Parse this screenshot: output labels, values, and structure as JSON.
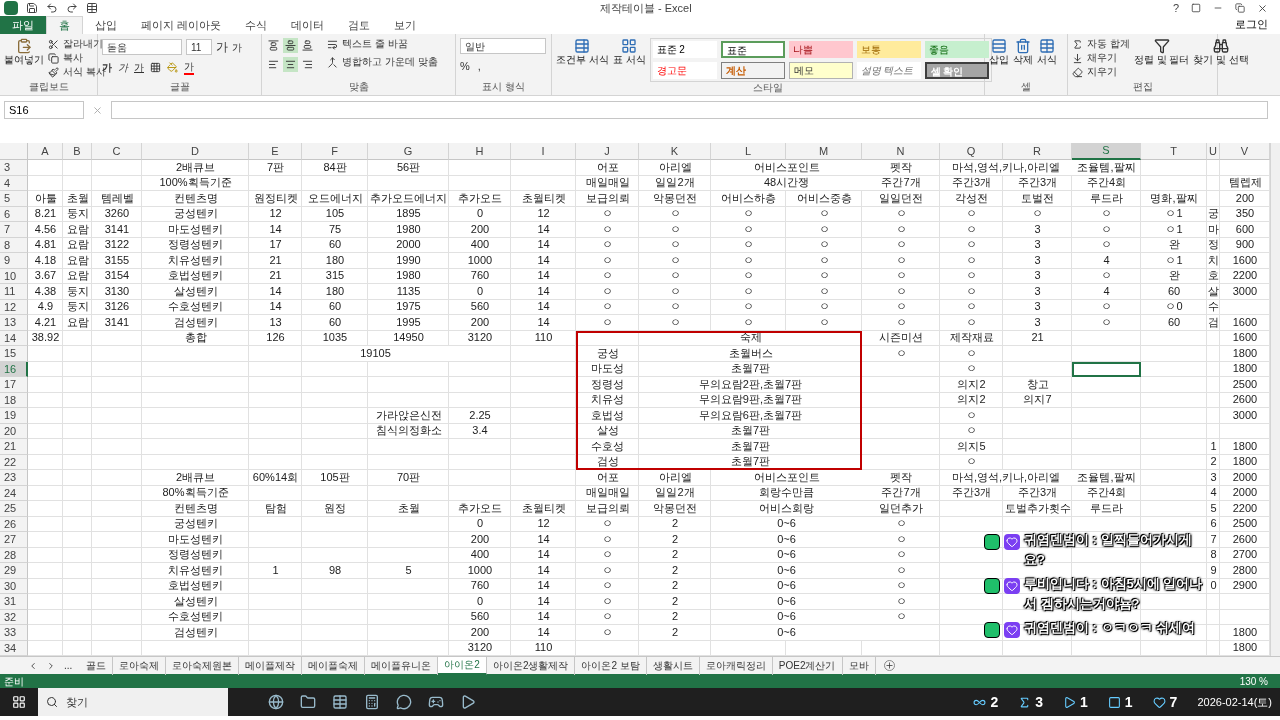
{
  "window": {
    "title": "제작테이블 - Excel",
    "help": "?"
  },
  "tabs": [
    {
      "label": "파일",
      "kind": "file",
      "selected": false
    },
    {
      "label": "홈",
      "kind": "tab",
      "selected": true
    },
    {
      "label": "삽입",
      "kind": "tab",
      "selected": false
    },
    {
      "label": "페이지 레이아웃",
      "kind": "tab",
      "selected": false
    },
    {
      "label": "수식",
      "kind": "tab",
      "selected": false
    },
    {
      "label": "데이터",
      "kind": "tab",
      "selected": false
    },
    {
      "label": "검토",
      "kind": "tab",
      "selected": false
    },
    {
      "label": "보기",
      "kind": "tab",
      "selected": false
    }
  ],
  "login": "로그인",
  "ribbon": [
    {
      "kind": "clipboard",
      "label": "클립보드",
      "paste": "붙여넣기",
      "items": [
        "잘라내기",
        "복사",
        "서식 복사"
      ]
    },
    {
      "kind": "font",
      "label": "글꼴",
      "font": "돋움",
      "size": "11",
      "size_buttons": [
        "가",
        "가"
      ],
      "style_buttons": [
        {
          "label": "가",
          "kind": "bold"
        },
        {
          "label": "가",
          "kind": "italic"
        },
        {
          "label": "가",
          "kind": "underline"
        }
      ],
      "color_button": "가"
    },
    {
      "kind": "alignment",
      "label": "맞춤",
      "vertical": [
        {
          "selected": false
        },
        {
          "selected": true
        },
        {
          "selected": false
        }
      ],
      "horizontal": [
        {
          "selected": false
        },
        {
          "selected": true
        },
        {
          "selected": false
        }
      ],
      "wrap": "텍스트 줄 바꿈",
      "merge": "병합하고 가운데 맞춤"
    },
    {
      "kind": "number",
      "label": "표시 형식",
      "format": "일반",
      "buttons": [
        "%",
        ","
      ]
    },
    {
      "kind": "styles",
      "label": "스타일",
      "conditional": "조건부 서식",
      "table": "표 서식",
      "cells": [
        {
          "label": "표준 2",
          "kind": "plain",
          "color": "#ffffff"
        },
        {
          "label": "표준",
          "kind": "normal",
          "color": "#ffffff"
        },
        {
          "label": "나쁨",
          "kind": "bad",
          "color": "#ffc7ce"
        },
        {
          "label": "보통",
          "kind": "neutral",
          "color": "#ffeb9c"
        },
        {
          "label": "좋음",
          "kind": "good",
          "color": "#c6efce"
        },
        {
          "label": "경고문",
          "kind": "warning",
          "color": "#ffffff"
        },
        {
          "label": "계산",
          "kind": "calc",
          "color": "#f2f2f2"
        },
        {
          "label": "메모",
          "kind": "note",
          "color": "#ffffcc"
        },
        {
          "label": "설명 텍스트",
          "kind": "explanatory",
          "color": "#ffffff"
        },
        {
          "label": "셀 확인",
          "kind": "check",
          "color": "#a5a5a5"
        }
      ]
    },
    {
      "kind": "cells",
      "label": "셀",
      "items": [
        "삽입",
        "삭제",
        "서식"
      ]
    },
    {
      "kind": "editing",
      "label": "편집",
      "items": [
        "자동 합계",
        "채우기",
        "지우기"
      ],
      "large": [
        "정렬 및 필터",
        "찾기 및 선택"
      ]
    }
  ],
  "formula_bar": {
    "name_box": "S16"
  },
  "columns": [
    {
      "label": "A",
      "selected": false
    },
    {
      "label": "B",
      "selected": false
    },
    {
      "label": "C",
      "selected": false
    },
    {
      "label": "D",
      "selected": false
    },
    {
      "label": "E",
      "selected": false
    },
    {
      "label": "F",
      "selected": false
    },
    {
      "label": "G",
      "selected": false
    },
    {
      "label": "H",
      "selected": false
    },
    {
      "label": "I",
      "selected": false
    },
    {
      "label": "J",
      "selected": false
    },
    {
      "label": "K",
      "selected": false
    },
    {
      "label": "L",
      "selected": false
    },
    {
      "label": "M",
      "selected": false
    },
    {
      "label": "N",
      "selected": false
    },
    {
      "label": "Q",
      "selected": false
    },
    {
      "label": "R",
      "selected": false
    },
    {
      "label": "S",
      "selected": true
    },
    {
      "label": "T",
      "selected": false
    },
    {
      "label": "U",
      "selected": false
    },
    {
      "label": "V",
      "selected": false
    }
  ],
  "rows": [
    {
      "label": "3",
      "selected": false,
      "cells": {
        "D": "2배큐브",
        "E": "7판",
        "F": "84판",
        "G": "56판",
        "J": "어포",
        "K": "아리엘",
        "L:M": "어비스포인트",
        "N": "펫작",
        "Q:R": "마석,영석,키나,아리엘",
        "S": "조율템,팔찌"
      }
    },
    {
      "label": "4",
      "selected": false,
      "cells": {
        "D": "100%획득기준",
        "J": "매일매일",
        "K": "일일2개",
        "L:M": "48시간쟁",
        "N": "주간7개",
        "Q": "주간3개",
        "R": "주간3개",
        "S": "주간4회",
        "V": "템렙제"
      }
    },
    {
      "label": "5",
      "selected": false,
      "cells": {
        "A": "아툴",
        "B": "초월",
        "C": "템레벨",
        "D": "컨텐츠명",
        "E": "원정티켓",
        "F": "오드에너지",
        "G": "추가오드에너지",
        "H": "추가오드",
        "I": "초월티켓",
        "J": "보급의뢰",
        "K": "악몽던전",
        "L": "어비스하층",
        "M": "어비스중층",
        "N": "일일던전",
        "Q": "각성전",
        "R": "토벌전",
        "S": "루드라",
        "T": "명화,팔찌",
        "V": "200"
      }
    },
    {
      "label": "6",
      "selected": false,
      "cells": {
        "A": "8.21",
        "B": "둥지",
        "C": "3260",
        "D": "궁성텐키",
        "E": "12",
        "F": "105",
        "G": "1895",
        "H": "0",
        "I": "12",
        "J": "ㅇ",
        "K": "ㅇ",
        "L": "ㅇ",
        "M": "ㅇ",
        "N": "ㅇ",
        "Q": "ㅇ",
        "R": "ㅇ",
        "S": "ㅇ",
        "T": "ㅇ1",
        "U": "궁",
        "V": "350"
      }
    },
    {
      "label": "7",
      "selected": false,
      "cells": {
        "A": "4.56",
        "B": "요람",
        "C": "3141",
        "D": "마도성텐키",
        "E": "14",
        "F": "75",
        "G": "1980",
        "H": "200",
        "I": "14",
        "J": "ㅇ",
        "K": "ㅇ",
        "L": "ㅇ",
        "M": "ㅇ",
        "N": "ㅇ",
        "Q": "ㅇ",
        "R": "3",
        "S": "ㅇ",
        "T": "ㅇ1",
        "U": "마",
        "V": "600"
      }
    },
    {
      "label": "8",
      "selected": false,
      "cells": {
        "A": "4.81",
        "B": "요람",
        "C": "3122",
        "D": "정령성텐키",
        "E": "17",
        "F": "60",
        "G": "2000",
        "H": "400",
        "I": "14",
        "J": "ㅇ",
        "K": "ㅇ",
        "L": "ㅇ",
        "M": "ㅇ",
        "N": "ㅇ",
        "Q": "ㅇ",
        "R": "3",
        "S": "ㅇ",
        "T": "완",
        "U": "정",
        "V": "900"
      }
    },
    {
      "label": "9",
      "selected": false,
      "cells": {
        "A": "4.18",
        "B": "요람",
        "C": "3155",
        "D": "치유성텐키",
        "E": "21",
        "F": "180",
        "G": "1990",
        "H": "1000",
        "I": "14",
        "J": "ㅇ",
        "K": "ㅇ",
        "L": "ㅇ",
        "M": "ㅇ",
        "N": "ㅇ",
        "Q": "ㅇ",
        "R": "3",
        "S": "4",
        "T": "ㅇ1",
        "U": "치",
        "V": "1600"
      }
    },
    {
      "label": "10",
      "selected": false,
      "cells": {
        "A": "3.67",
        "B": "요람",
        "C": "3154",
        "D": "호법성텐키",
        "E": "21",
        "F": "315",
        "G": "1980",
        "H": "760",
        "I": "14",
        "J": "ㅇ",
        "K": "ㅇ",
        "L": "ㅇ",
        "M": "ㅇ",
        "N": "ㅇ",
        "Q": "ㅇ",
        "R": "3",
        "S": "ㅇ",
        "T": "완",
        "U": "호",
        "V": "2200"
      }
    },
    {
      "label": "11",
      "selected": false,
      "cells": {
        "A": "4.38",
        "B": "둥지",
        "C": "3130",
        "D": "살성텐키",
        "E": "14",
        "F": "180",
        "G": "1135",
        "H": "0",
        "I": "14",
        "J": "ㅇ",
        "K": "ㅇ",
        "L": "ㅇ",
        "M": "ㅇ",
        "N": "ㅇ",
        "Q": "ㅇ",
        "R": "3",
        "S": "4",
        "T": "60",
        "U": "살",
        "V": "3000"
      }
    },
    {
      "label": "12",
      "selected": false,
      "cells": {
        "A": "4.9",
        "B": "둥지",
        "C": "3126",
        "D": "수호성텐키",
        "E": "14",
        "F": "60",
        "G": "1975",
        "H": "560",
        "I": "14",
        "J": "ㅇ",
        "K": "ㅇ",
        "L": "ㅇ",
        "M": "ㅇ",
        "N": "ㅇ",
        "Q": "ㅇ",
        "R": "3",
        "S": "ㅇ",
        "T": "ㅇ0",
        "U": "수"
      }
    },
    {
      "label": "13",
      "selected": false,
      "cells": {
        "A": "4.21",
        "B": "요람",
        "C": "3141",
        "D": "검성텐키",
        "E": "13",
        "F": "60",
        "G": "1995",
        "H": "200",
        "I": "14",
        "J": "ㅇ",
        "K": "ㅇ",
        "L": "ㅇ",
        "M": "ㅇ",
        "N": "ㅇ",
        "Q": "ㅇ",
        "R": "3",
        "S": "ㅇ",
        "T": "60",
        "U": "검",
        "V": "1600"
      }
    },
    {
      "label": "14",
      "selected": false,
      "cells": {
        "A": "38.92",
        "D": "총합",
        "E": "126",
        "F": "1035",
        "G": "14950",
        "H": "3120",
        "I": "110",
        "K:M": "숙제",
        "N": "시즌미션",
        "Q": "제작재료",
        "R": "21",
        "V": "1600"
      }
    },
    {
      "label": "15",
      "selected": false,
      "cells": {
        "F:G": "19105",
        "J": "궁성",
        "K:M": "초월버스",
        "N": "ㅇ",
        "Q": "ㅇ",
        "V": "1800"
      }
    },
    {
      "label": "16",
      "selected": true,
      "cells": {
        "J": "마도성",
        "K:M": "초월7판",
        "Q": "ㅇ",
        "V": "1800"
      }
    },
    {
      "label": "17",
      "selected": false,
      "cells": {
        "J": "정령성",
        "K:M": "무의요람2판,초월7판",
        "Q": "의지2",
        "R": "창고",
        "V": "2500"
      }
    },
    {
      "label": "18",
      "selected": false,
      "cells": {
        "J": "치유성",
        "K:M": "무의요람9판,초월7판",
        "Q": "의지2",
        "R": "의지7",
        "V": "2600"
      }
    },
    {
      "label": "19",
      "selected": false,
      "cells": {
        "G": "가라앉은신전",
        "H": "2.25",
        "J": "호법성",
        "K:M": "무의요람6판,초월7판",
        "Q": "ㅇ",
        "V": "3000"
      }
    },
    {
      "label": "20",
      "selected": false,
      "cells": {
        "G": "침식의정화소",
        "H": "3.4",
        "J": "살성",
        "K:M": "초월7판",
        "Q": "ㅇ"
      }
    },
    {
      "label": "21",
      "selected": false,
      "cells": {
        "J": "수호성",
        "K:M": "초월7판",
        "Q": "의지5",
        "U": "1",
        "V": "1800"
      }
    },
    {
      "label": "22",
      "selected": false,
      "cells": {
        "J": "검성",
        "K:M": "초월7판",
        "Q": "ㅇ",
        "U": "2",
        "V": "1800"
      }
    },
    {
      "label": "23",
      "selected": false,
      "cells": {
        "D": "2배큐브",
        "E": "60%14회",
        "F": "105판",
        "G": "70판",
        "J": "어포",
        "K": "아리엘",
        "L:M": "어비스포인트",
        "N": "펫작",
        "Q:R": "마석,영석,키나,아리엘",
        "S": "조율템,팔찌",
        "U": "3",
        "V": "2000"
      }
    },
    {
      "label": "24",
      "selected": false,
      "cells": {
        "D": "80%획득기준",
        "J": "매일매일",
        "K": "일일2개",
        "L:M": "회랑수만큼",
        "N": "주간7개",
        "Q": "주간3개",
        "R": "주간3개",
        "S": "주간4회",
        "U": "4",
        "V": "2000"
      }
    },
    {
      "label": "25",
      "selected": false,
      "cells": {
        "D": "컨텐츠명",
        "E": "탐험",
        "F": "원정",
        "G": "초월",
        "H": "추가오드",
        "I": "초월티켓",
        "J": "보급의뢰",
        "K": "악몽던전",
        "L:M": "어비스회랑",
        "N": "일던추가",
        "R": "토벌추가횟수",
        "S": "루드라",
        "U": "5",
        "V": "2200"
      }
    },
    {
      "label": "26",
      "selected": false,
      "cells": {
        "D": "궁성텐키",
        "H": "0",
        "I": "12",
        "J": "ㅇ",
        "K": "2",
        "L:M": "0~6",
        "N": "ㅇ",
        "U": "6",
        "V": "2500"
      }
    },
    {
      "label": "27",
      "selected": false,
      "cells": {
        "D": "마도성텐키",
        "H": "200",
        "I": "14",
        "J": "ㅇ",
        "K": "2",
        "L:M": "0~6",
        "N": "ㅇ",
        "U": "7",
        "V": "2600"
      }
    },
    {
      "label": "28",
      "selected": false,
      "cells": {
        "D": "정령성텐키",
        "H": "400",
        "I": "14",
        "J": "ㅇ",
        "K": "2",
        "L:M": "0~6",
        "N": "ㅇ",
        "U": "8",
        "V": "2700"
      }
    },
    {
      "label": "29",
      "selected": false,
      "cells": {
        "D": "치유성텐키",
        "E": "1",
        "F": "98",
        "G": "5",
        "H": "1000",
        "I": "14",
        "J": "ㅇ",
        "K": "2",
        "L:M": "0~6",
        "N": "ㅇ",
        "U": "9",
        "V": "2800"
      }
    },
    {
      "label": "30",
      "selected": false,
      "cells": {
        "D": "호법성텐키",
        "H": "760",
        "I": "14",
        "J": "ㅇ",
        "K": "2",
        "L:M": "0~6",
        "N": "ㅇ",
        "U": "0",
        "V": "2900"
      }
    },
    {
      "label": "31",
      "selected": false,
      "cells": {
        "D": "살성텐키",
        "H": "0",
        "I": "14",
        "J": "ㅇ",
        "K": "2",
        "L:M": "0~6",
        "N": "ㅇ"
      }
    },
    {
      "label": "32",
      "selected": false,
      "cells": {
        "D": "수호성텐키",
        "H": "560",
        "I": "14",
        "J": "ㅇ",
        "K": "2",
        "L:M": "0~6",
        "N": "ㅇ"
      }
    },
    {
      "label": "33",
      "selected": false,
      "cells": {
        "D": "검성텐키",
        "H": "200",
        "I": "14",
        "J": "ㅇ",
        "K": "2",
        "L:M": "0~6",
        "V": "1800"
      }
    },
    {
      "label": "34",
      "selected": false,
      "cells": {
        "H": "3120",
        "I": "110",
        "V": "1800"
      }
    }
  ],
  "sheet_nav": "...",
  "sheets": [
    {
      "label": "골드",
      "selected": false
    },
    {
      "label": "로아숙제",
      "selected": false
    },
    {
      "label": "로아숙제원본",
      "selected": false
    },
    {
      "label": "메이플제작",
      "selected": false
    },
    {
      "label": "메이플숙제",
      "selected": false
    },
    {
      "label": "메이플유니온",
      "selected": false
    },
    {
      "label": "아이온2",
      "selected": true
    },
    {
      "label": "아이온2생활제작",
      "selected": false
    },
    {
      "label": "아이온2 보탐",
      "selected": false
    },
    {
      "label": "생활시트",
      "selected": false
    },
    {
      "label": "로아캐릭정리",
      "selected": false
    },
    {
      "label": "POE2계산기",
      "selected": false
    },
    {
      "label": "모바",
      "selected": false
    }
  ],
  "status_bar": {
    "status": "준비",
    "zoom": "130 %"
  },
  "chat": [
    "귀염덴범이 : 일찍들어가시게요?",
    "루비입니다 : 아침5시에 일어나서 겜하시는거야뇸?",
    "귀염덴범이 : ㅇㅋㅇㅋ 쉬세여"
  ],
  "taskbar": {
    "search": "찾기",
    "stats": [
      "2",
      "3",
      "1",
      "1",
      "7"
    ],
    "date": "2026-02-14(토)"
  }
}
